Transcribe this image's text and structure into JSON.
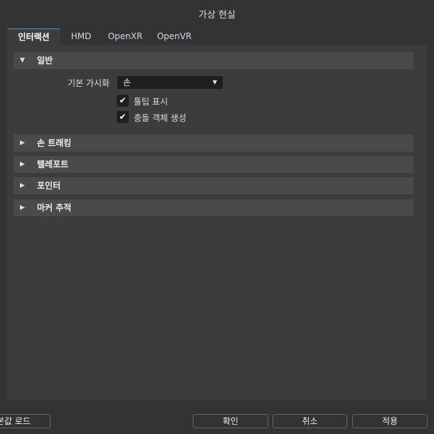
{
  "window": {
    "title": "가상 현실"
  },
  "tabs": [
    {
      "label": "인터랙션"
    },
    {
      "label": "HMD"
    },
    {
      "label": "OpenXR"
    },
    {
      "label": "OpenVR"
    }
  ],
  "sections": [
    {
      "label": "일반"
    },
    {
      "label": "손 트래킹"
    },
    {
      "label": "텔레포트"
    },
    {
      "label": "포인터"
    },
    {
      "label": "마커 추적"
    }
  ],
  "general": {
    "visualization_label": "기본 가시화",
    "visualization_value": "손",
    "tooltips_label": "툴팁 표시",
    "tooltips_checked": true,
    "collision_label": "충돌 객체 생성",
    "collision_checked": true
  },
  "footer": {
    "load_defaults": "본값 로드",
    "ok": "확인",
    "cancel": "취소",
    "apply": "적용"
  }
}
